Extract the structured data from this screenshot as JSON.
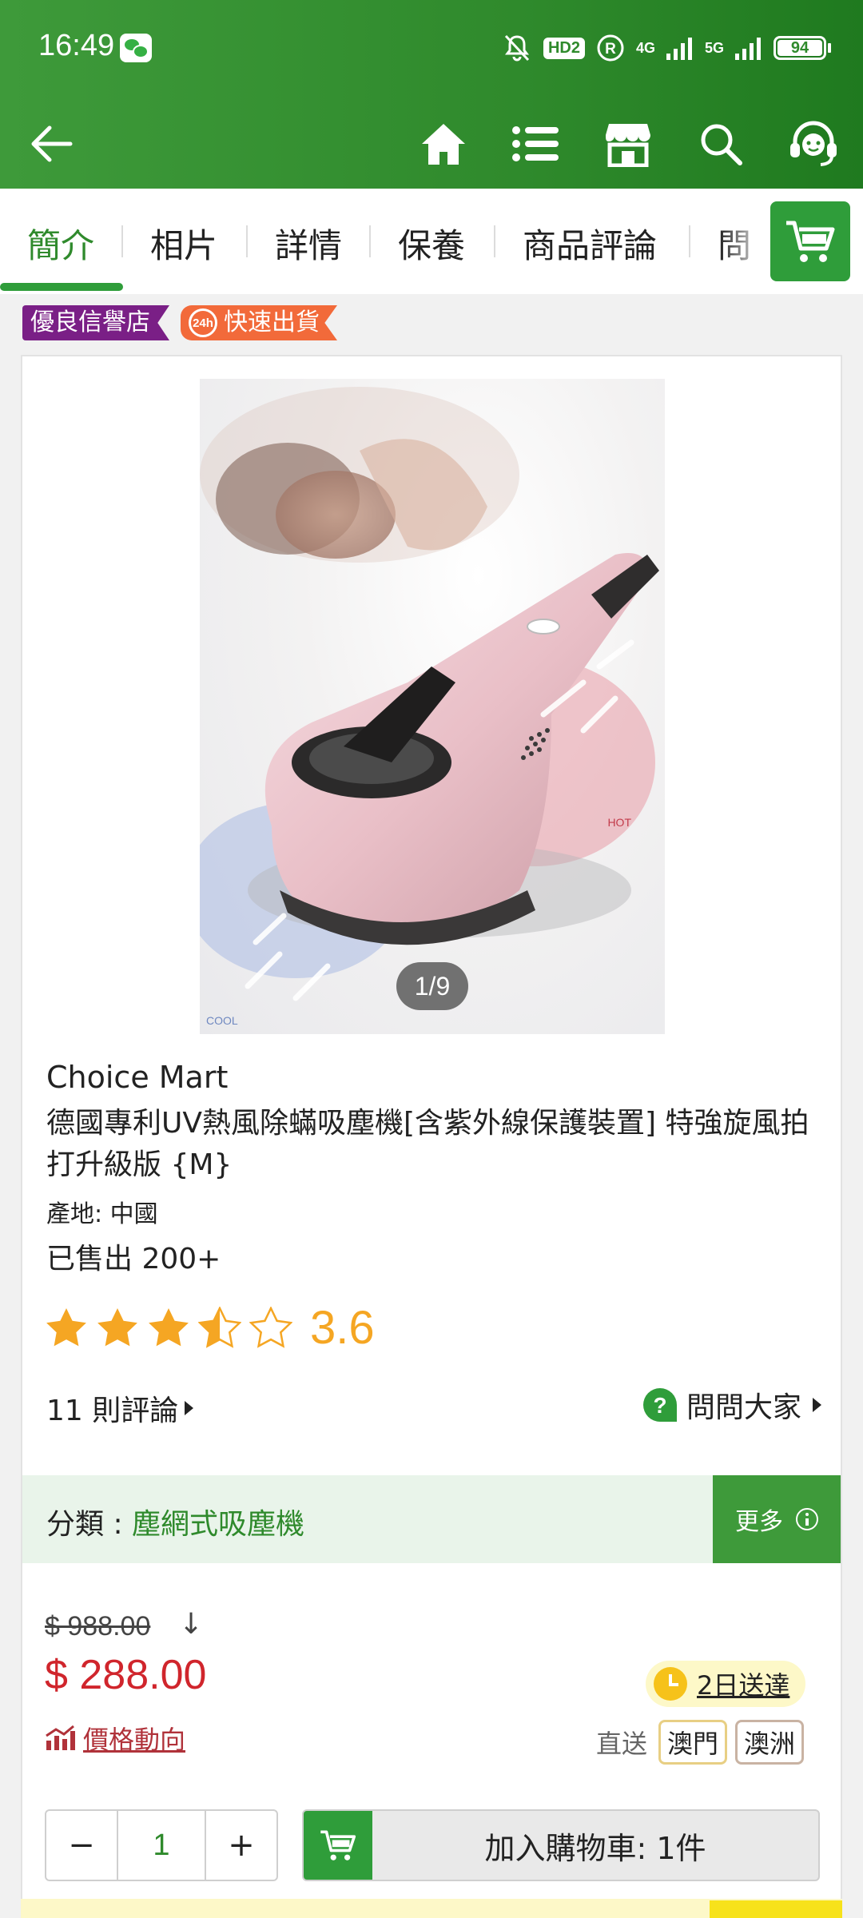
{
  "status_bar": {
    "time": "16:49",
    "hd_label": "HD2",
    "net_4g": "4G",
    "net_5g": "5G",
    "battery": "94",
    "icons": [
      "wechat-icon",
      "mute-bell-icon",
      "hd-icon",
      "registered-icon",
      "signal-icon",
      "battery-icon"
    ]
  },
  "app_bar": {
    "icons": [
      "back-arrow-icon",
      "home-icon",
      "list-icon",
      "store-icon",
      "search-icon",
      "support-headset-icon"
    ]
  },
  "tabs": [
    {
      "label": "簡介",
      "active": true
    },
    {
      "label": "相片"
    },
    {
      "label": "詳情"
    },
    {
      "label": "保養"
    },
    {
      "label": "商品評論"
    },
    {
      "label": "問"
    }
  ],
  "badges": {
    "store": "優良信譽店",
    "fast_icon_label": "24h",
    "fast": "快速出貨"
  },
  "product": {
    "image_counter": "1/9",
    "image_text_hot": "HOT",
    "image_text_cool": "COOL",
    "brand": "Choice Mart",
    "title": "德國專利UV熱風除蟎吸塵機[含紫外線保護裝置] 特強旋風拍打升級版 {M}",
    "origin": "產地: 中國",
    "sold": "已售出 200+",
    "rating": 3.6,
    "rating_text": "3.6",
    "reviews": "11 則評論",
    "ask": "問問大家"
  },
  "category": {
    "label": "分類 : ",
    "value": "塵網式吸塵機",
    "more": "更多"
  },
  "pricing": {
    "original": "$ 988.00",
    "arrow": "↓",
    "current": "$ 288.00",
    "trend": "價格動向",
    "delivery": "2日送達",
    "ship_label": "直送",
    "ship_tags": [
      "澳門",
      "澳洲"
    ]
  },
  "purchase": {
    "minus": "−",
    "plus": "+",
    "quantity": "1",
    "add_to_cart": "加入購物車: 1件"
  },
  "colors": {
    "brand_green": "#2f8a2c",
    "price_red": "#d0252c",
    "star_yellow": "#f5a623",
    "store_badge": "#7a1f86",
    "fast_badge": "#f26a3a"
  }
}
